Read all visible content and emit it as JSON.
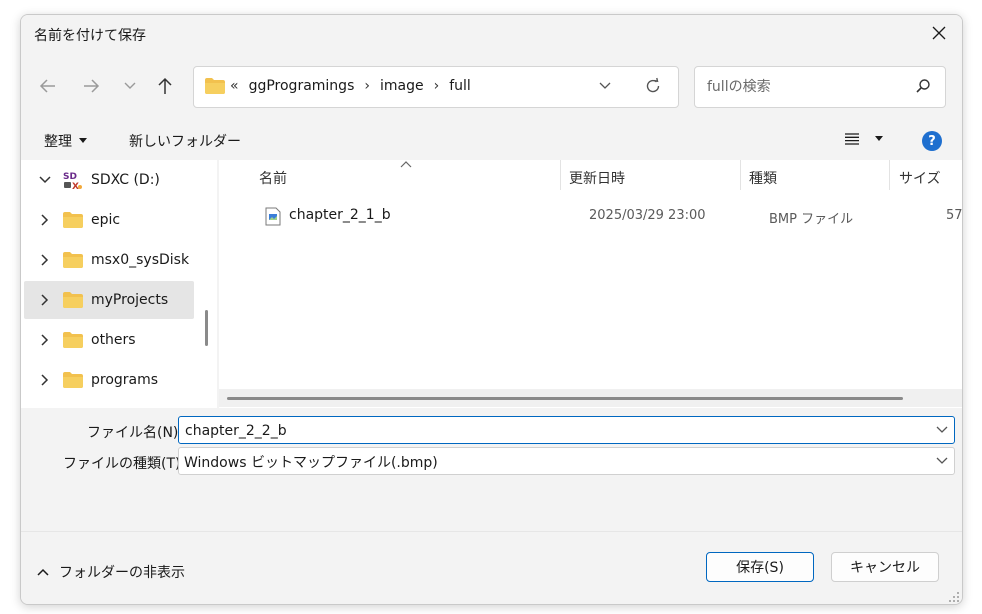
{
  "dialog": {
    "title": "名前を付けて保存"
  },
  "nav": {
    "crumb_prefix": "«",
    "breadcrumbs": [
      "ggProgramings",
      "image",
      "full"
    ],
    "search_placeholder": "fullの検索"
  },
  "toolbar": {
    "organize_label": "整理",
    "new_folder_label": "新しいフォルダー",
    "help_label": "?"
  },
  "sidebar": {
    "items": [
      {
        "label": "SDXC (D:)",
        "icon": "sd-card-drive-icon",
        "expanded": true
      },
      {
        "label": "epic",
        "icon": "folder-icon"
      },
      {
        "label": "msx0_sysDisk",
        "icon": "folder-icon"
      },
      {
        "label": "myProjects",
        "icon": "folder-icon",
        "selected": true
      },
      {
        "label": "others",
        "icon": "folder-icon"
      },
      {
        "label": "programs",
        "icon": "folder-icon"
      }
    ]
  },
  "files": {
    "columns": [
      "名前",
      "更新日時",
      "種類",
      "サイズ"
    ],
    "rows": [
      {
        "name": "chapter_2_1_b",
        "modified": "2025/03/29 23:00",
        "type": "BMP ファイル",
        "size": "57"
      }
    ]
  },
  "form": {
    "filename_label": "ファイル名(N):",
    "filename_value": "chapter_2_2_b",
    "filetype_label": "ファイルの種類(T):",
    "filetype_value": "Windows ビットマップファイル(.bmp)"
  },
  "footer": {
    "hide_folders_label": "フォルダーの非表示",
    "save_label": "保存(S)",
    "cancel_label": "キャンセル"
  },
  "colors": {
    "accent": "#0067c0",
    "folder": "#f2c14e",
    "help": "#1e6fcf"
  }
}
